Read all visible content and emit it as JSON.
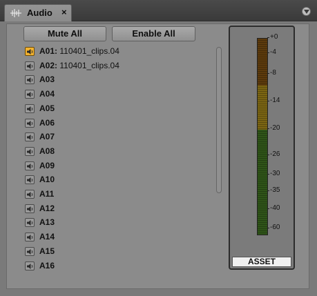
{
  "window": {
    "tab_title": "Audio",
    "tab_icon": "waveform-icon",
    "close_symbol": "×",
    "menu_icon": "panel-menu-icon"
  },
  "toolbar": {
    "mute_all_label": "Mute All",
    "enable_all_label": "Enable All"
  },
  "tracks": [
    {
      "name": "A01:",
      "clip": "110401_clips.04",
      "active": true
    },
    {
      "name": "A02:",
      "clip": "110401_clips.04",
      "active": false
    },
    {
      "name": "A03",
      "clip": "",
      "active": false
    },
    {
      "name": "A04",
      "clip": "",
      "active": false
    },
    {
      "name": "A05",
      "clip": "",
      "active": false
    },
    {
      "name": "A06",
      "clip": "",
      "active": false
    },
    {
      "name": "A07",
      "clip": "",
      "active": false
    },
    {
      "name": "A08",
      "clip": "",
      "active": false
    },
    {
      "name": "A09",
      "clip": "",
      "active": false
    },
    {
      "name": "A10",
      "clip": "",
      "active": false
    },
    {
      "name": "A11",
      "clip": "",
      "active": false
    },
    {
      "name": "A12",
      "clip": "",
      "active": false
    },
    {
      "name": "A13",
      "clip": "",
      "active": false
    },
    {
      "name": "A14",
      "clip": "",
      "active": false
    },
    {
      "name": "A15",
      "clip": "",
      "active": false
    },
    {
      "name": "A16",
      "clip": "",
      "active": false
    }
  ],
  "meter": {
    "scale_labels": [
      "+0",
      "-4",
      "-8",
      "-14",
      "-20",
      "-26",
      "-30",
      "-35",
      "-40",
      "-60"
    ],
    "zones": [
      {
        "name": "red",
        "color": "#5c3a0c"
      },
      {
        "name": "yellow",
        "color": "#7a6412"
      },
      {
        "name": "green",
        "color": "#2f5418"
      }
    ],
    "asset_label": "ASSET"
  },
  "colors": {
    "active_speaker": "#f2b22f",
    "inactive_speaker": "#9a9a9a",
    "panel_bg": "#8b8b8b"
  }
}
